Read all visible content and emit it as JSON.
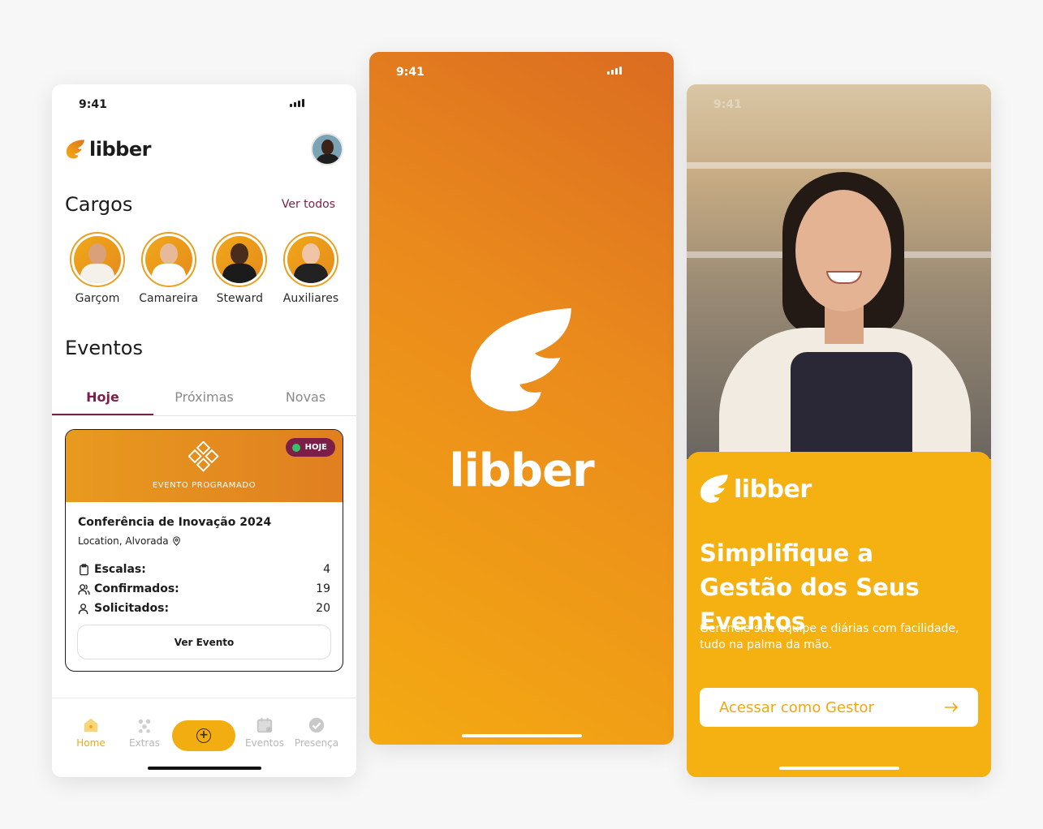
{
  "status": {
    "time": "9:41"
  },
  "brand": {
    "name": "libber"
  },
  "home": {
    "cargos_title": "Cargos",
    "ver_todos": "Ver todos",
    "cargos": [
      {
        "label": "Garçom"
      },
      {
        "label": "Camareira"
      },
      {
        "label": "Steward"
      },
      {
        "label": "Auxiliares"
      }
    ],
    "eventos_title": "Eventos",
    "tabs": [
      {
        "label": "Hoje",
        "active": true
      },
      {
        "label": "Próximas",
        "active": false
      },
      {
        "label": "Novas",
        "active": false
      }
    ],
    "event": {
      "badge": "HOJE",
      "header_label": "EVENTO PROGRAMADO",
      "name": "Conferência de Inovação 2024",
      "location": "Location, Alvorada",
      "stats": [
        {
          "label": "Escalas:",
          "value": "4",
          "icon": "clipboard-icon"
        },
        {
          "label": "Confirmados:",
          "value": "19",
          "icon": "users-icon"
        },
        {
          "label": "Solicitados:",
          "value": "20",
          "icon": "user-icon"
        }
      ],
      "button": "Ver Evento"
    },
    "nav": {
      "home": "Home",
      "extras": "Extras",
      "eventos": "Eventos",
      "presenca": "Presença"
    }
  },
  "onboarding": {
    "headline": "Simplifique a Gestão dos Seus Eventos",
    "subline": "Gerencie sua equipe e diárias com facilidade, tudo na palma da mão.",
    "cta": "Acessar como Gestor"
  },
  "colors": {
    "brand_orange": "#f2ad11",
    "brand_dark_orange": "#db6c21",
    "accent_wine": "#7b1f49"
  }
}
